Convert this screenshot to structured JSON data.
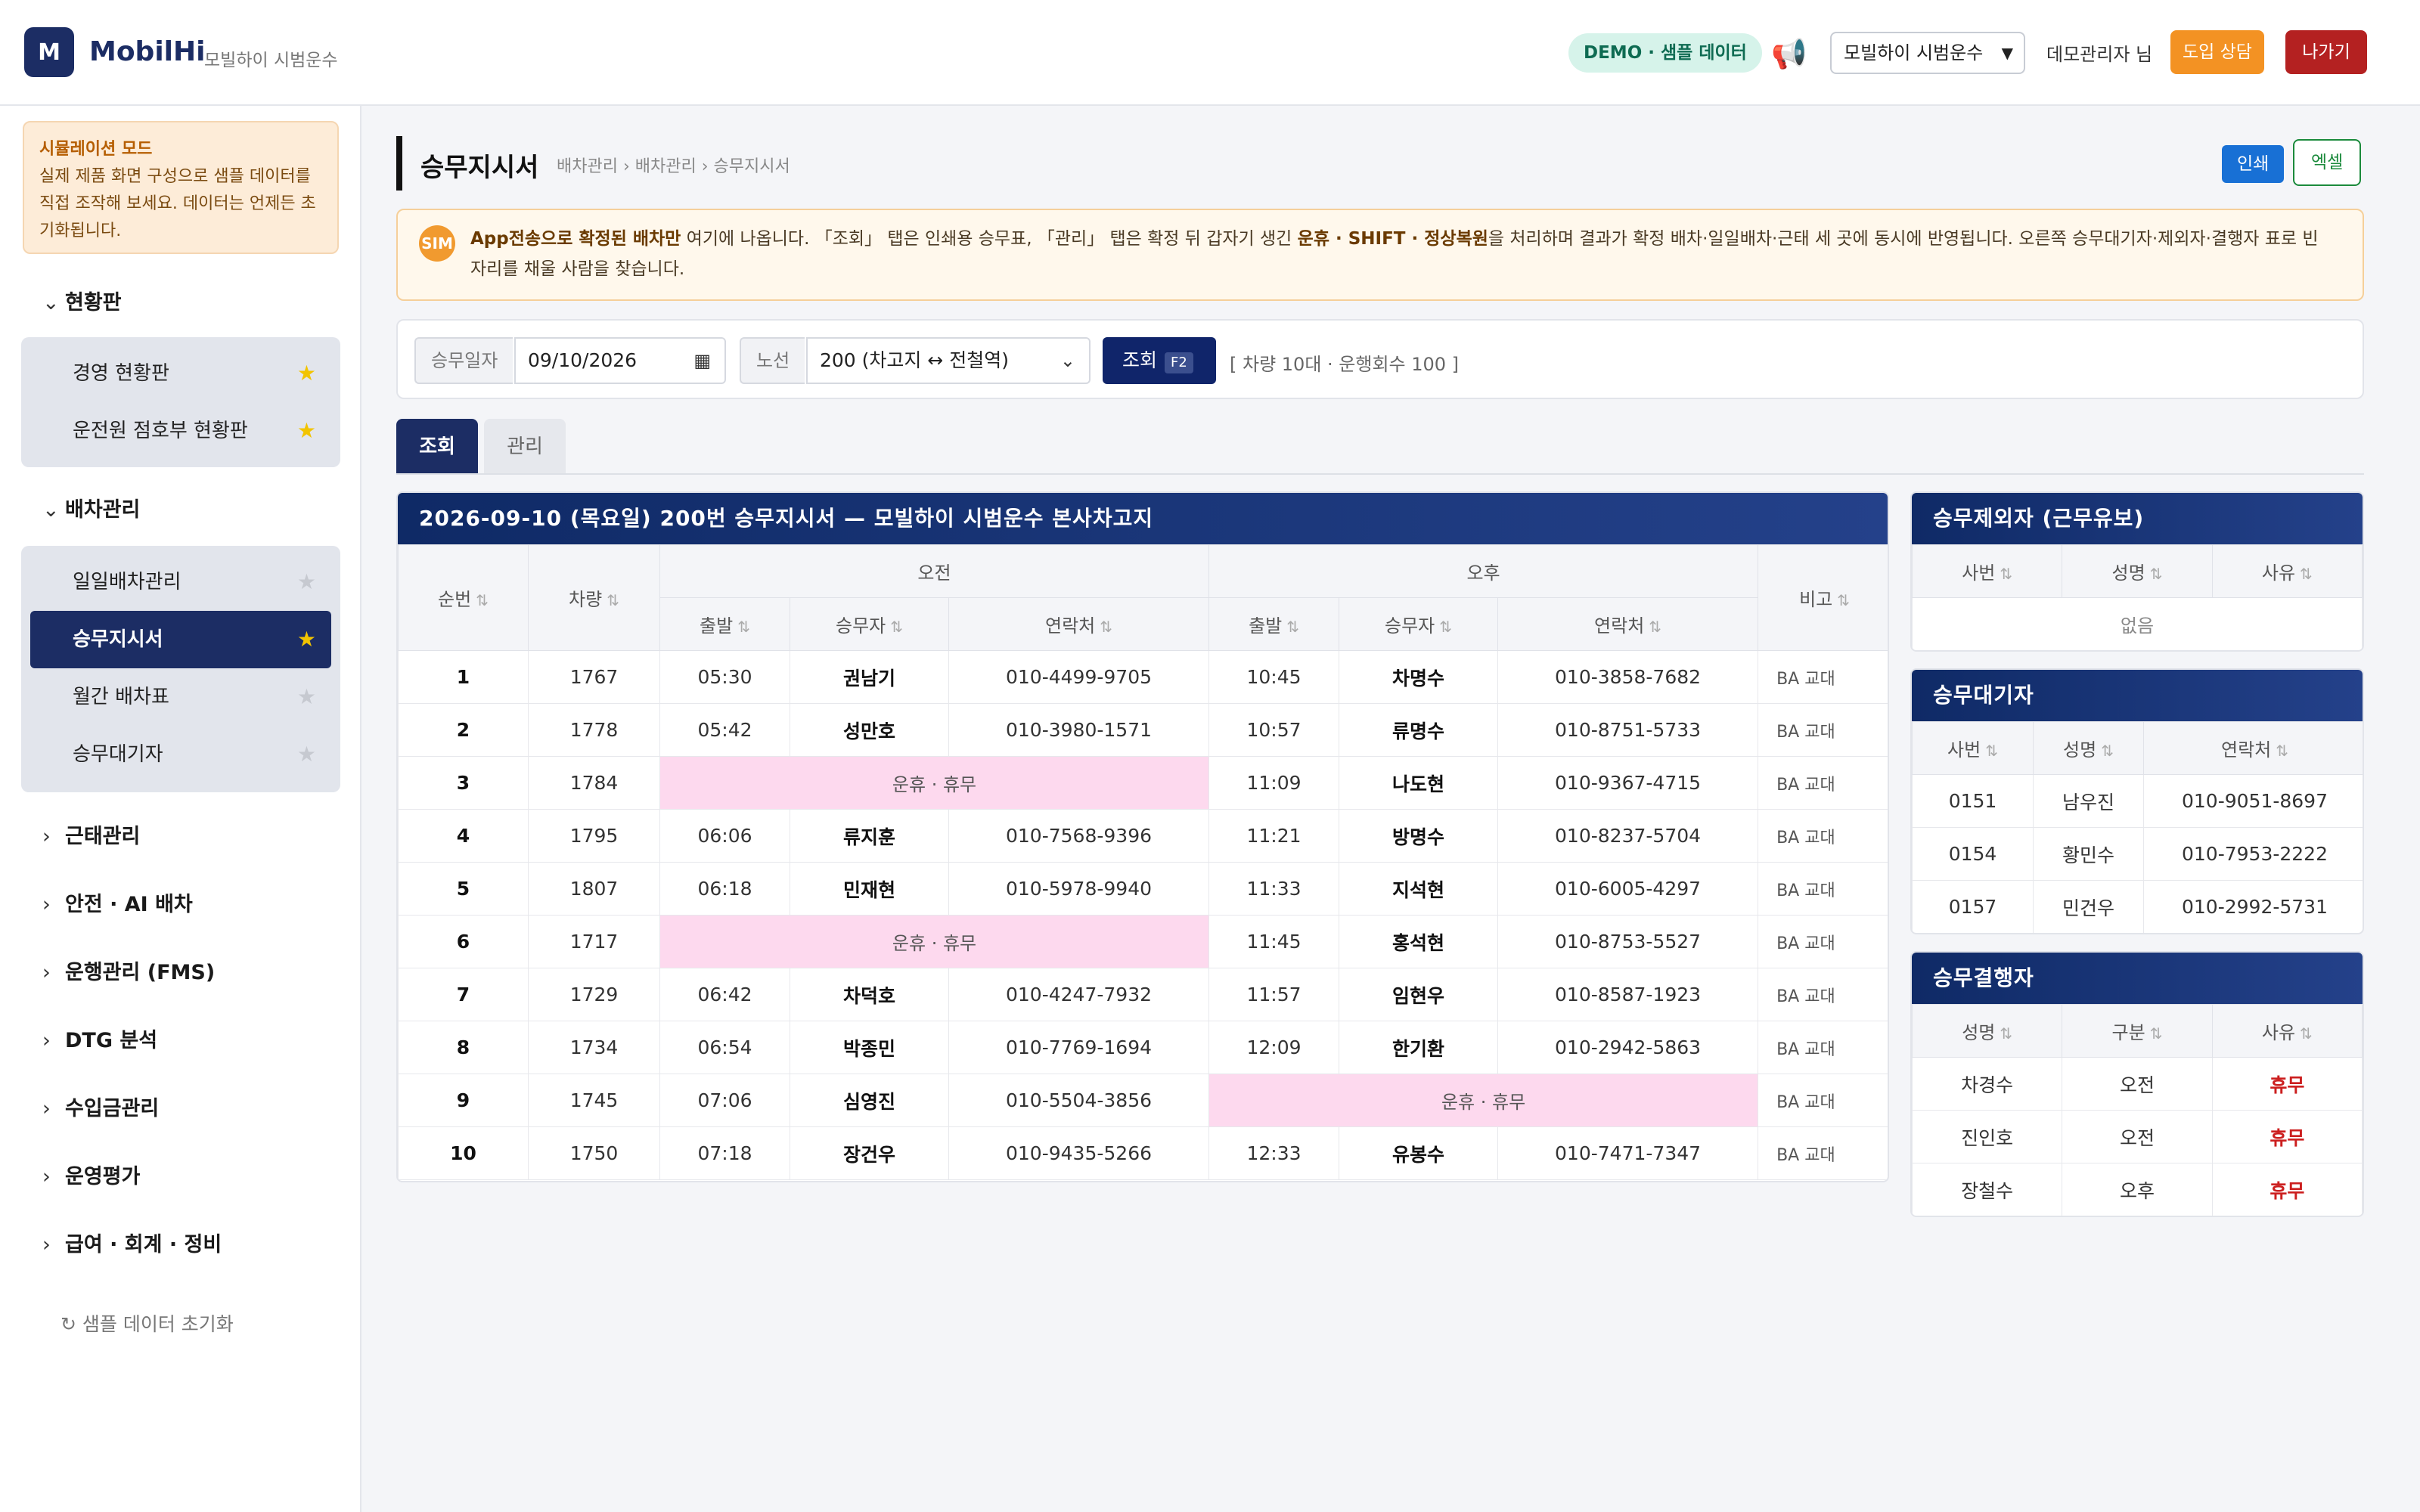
{
  "header": {
    "logo_letter": "M",
    "brand": "MobilHi",
    "brand_sub": "모빌하이 시범운수",
    "demo_badge": "DEMO · 샘플 데이터",
    "company_select": "모빌하이 시범운수",
    "user_name": "데모관리자 님",
    "consult_button": "도입 상담",
    "exit_button": "나가기"
  },
  "sidebar": {
    "sim_title": "시뮬레이션 모드",
    "sim_text": "실제 제품 화면 구성으로 샘플 데이터를 직접 조작해 보세요. 데이터는 언제든 초기화됩니다.",
    "sections": [
      {
        "label": "현황판",
        "items": [
          {
            "label": "경영 현황판"
          },
          {
            "label": "운전원 점호부 현황판"
          }
        ]
      },
      {
        "label": "배차관리",
        "items": [
          {
            "label": "일일배차관리"
          },
          {
            "label": "승무지시서"
          },
          {
            "label": "월간 배차표"
          },
          {
            "label": "승무대기자"
          }
        ]
      },
      {
        "label": "근태관리"
      },
      {
        "label": "안전 · AI 배차"
      },
      {
        "label": "운행관리 (FMS)"
      },
      {
        "label": "DTG 분석"
      },
      {
        "label": "수입금관리"
      },
      {
        "label": "운영평가"
      },
      {
        "label": "급여 · 회계 · 정비"
      }
    ],
    "reset_label": "샘플 데이터 초기화"
  },
  "page": {
    "title": "승무지시서",
    "breadcrumb": "배차관리 › 배차관리 › 승무지시서",
    "print_button": "인쇄",
    "excel_button": "엑셀",
    "info_bold1": "App전송으로 확정된 배차만",
    "info_text1": " 여기에 나옵니다. 「조회」 탭은 인쇄용 승무표, 「관리」 탭은 확정 뒤 갑자기 생긴 ",
    "info_bold2": "운휴 · SHIFT · 정상복원",
    "info_text2": "을 처리하며 결과가 확정 배차·일일배차·근태 세 곳에 동시에 반영됩니다. 오른쪽 승무대기자·제외자·결행자 표로 빈자리를 채울 사람을 찾습니다.",
    "sim_badge": "SIM"
  },
  "filter": {
    "date_label": "승무일자",
    "date_value": "09/10/2026",
    "route_label": "노선",
    "route_value": "200 (차고지 ↔ 전철역)",
    "query_button": "조회",
    "query_key": "F2",
    "summary": "[ 차량 10대 · 운행회수 100 ]"
  },
  "tabs": {
    "view": "조회",
    "manage": "관리"
  },
  "order_table": {
    "title": "2026-09-10 (목요일) 200번 승무지시서 — 모빌하이 시범운수 본사차고지",
    "headers": {
      "seq": "순번",
      "vehicle": "차량",
      "am": "오전",
      "pm": "오후",
      "note": "비고",
      "depart": "출발",
      "driver": "승무자",
      "phone": "연락처"
    },
    "off_label": "운휴 · 휴무",
    "rows": [
      {
        "seq": "1",
        "vehicle": "1767",
        "am_time": "05:30",
        "am_driver": "권남기",
        "am_phone": "010-4499-9705",
        "pm_time": "10:45",
        "pm_driver": "차명수",
        "pm_phone": "010-3858-7682",
        "note": "BA 교대"
      },
      {
        "seq": "2",
        "vehicle": "1778",
        "am_time": "05:42",
        "am_driver": "성만호",
        "am_phone": "010-3980-1571",
        "pm_time": "10:57",
        "pm_driver": "류명수",
        "pm_phone": "010-8751-5733",
        "note": "BA 교대"
      },
      {
        "seq": "3",
        "vehicle": "1784",
        "am_off": true,
        "pm_time": "11:09",
        "pm_driver": "나도현",
        "pm_phone": "010-9367-4715",
        "note": "BA 교대"
      },
      {
        "seq": "4",
        "vehicle": "1795",
        "am_time": "06:06",
        "am_driver": "류지훈",
        "am_phone": "010-7568-9396",
        "pm_time": "11:21",
        "pm_driver": "방명수",
        "pm_phone": "010-8237-5704",
        "note": "BA 교대"
      },
      {
        "seq": "5",
        "vehicle": "1807",
        "am_time": "06:18",
        "am_driver": "민재현",
        "am_phone": "010-5978-9940",
        "pm_time": "11:33",
        "pm_driver": "지석현",
        "pm_phone": "010-6005-4297",
        "note": "BA 교대"
      },
      {
        "seq": "6",
        "vehicle": "1717",
        "am_off": true,
        "pm_time": "11:45",
        "pm_driver": "홍석현",
        "pm_phone": "010-8753-5527",
        "note": "BA 교대"
      },
      {
        "seq": "7",
        "vehicle": "1729",
        "am_time": "06:42",
        "am_driver": "차덕호",
        "am_phone": "010-4247-7932",
        "pm_time": "11:57",
        "pm_driver": "임현우",
        "pm_phone": "010-8587-1923",
        "note": "BA 교대"
      },
      {
        "seq": "8",
        "vehicle": "1734",
        "am_time": "06:54",
        "am_driver": "박종민",
        "am_phone": "010-7769-1694",
        "pm_time": "12:09",
        "pm_driver": "한기환",
        "pm_phone": "010-2942-5863",
        "note": "BA 교대"
      },
      {
        "seq": "9",
        "vehicle": "1745",
        "am_time": "07:06",
        "am_driver": "심영진",
        "am_phone": "010-5504-3856",
        "pm_off": true,
        "note": "BA 교대"
      },
      {
        "seq": "10",
        "vehicle": "1750",
        "am_time": "07:18",
        "am_driver": "장건우",
        "am_phone": "010-9435-5266",
        "pm_time": "12:33",
        "pm_driver": "유봉수",
        "pm_phone": "010-7471-7347",
        "note": "BA 교대"
      }
    ]
  },
  "excluded": {
    "title": "승무제외자 (근무유보)",
    "headers": [
      "사번",
      "성명",
      "사유"
    ],
    "empty": "없음"
  },
  "standby": {
    "title": "승무대기자",
    "headers": [
      "사번",
      "성명",
      "연락처"
    ],
    "rows": [
      [
        "0151",
        "남우진",
        "010-9051-8697"
      ],
      [
        "0154",
        "황민수",
        "010-7953-2222"
      ],
      [
        "0157",
        "민건우",
        "010-2992-5731"
      ]
    ]
  },
  "absent": {
    "title": "승무결행자",
    "headers": [
      "성명",
      "구분",
      "사유"
    ],
    "rows": [
      [
        "차경수",
        "오전",
        "휴무"
      ],
      [
        "진인호",
        "오전",
        "휴무"
      ],
      [
        "장철수",
        "오후",
        "휴무"
      ]
    ]
  }
}
